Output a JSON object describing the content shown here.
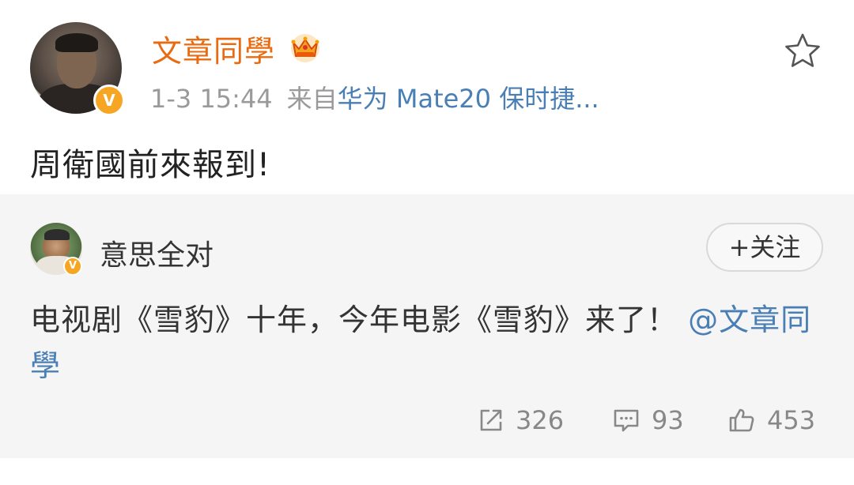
{
  "post": {
    "username": "文章同學",
    "time": "1-3 15:44",
    "from_label": "来自",
    "source": "华为 Mate20 保时捷...",
    "text": "周衛國前來報到!",
    "badge": "V",
    "icons": [
      "crown-icon",
      "star-icon",
      "verified-icon"
    ]
  },
  "repost": {
    "username": "意思全对",
    "follow_label": "+关注",
    "text": "电视剧《雪豹》十年，今年电影《雪豹》来了！",
    "mention": "@文章同學",
    "badge": "V",
    "stats": {
      "reposts": "326",
      "comments": "93",
      "likes": "453"
    },
    "icons": [
      "repost-icon",
      "comment-icon",
      "like-icon"
    ]
  },
  "colors": {
    "username": "#e86b12",
    "link": "#4a7fb5",
    "verified": "#f6a623",
    "repost_background": "#f5f5f5"
  }
}
